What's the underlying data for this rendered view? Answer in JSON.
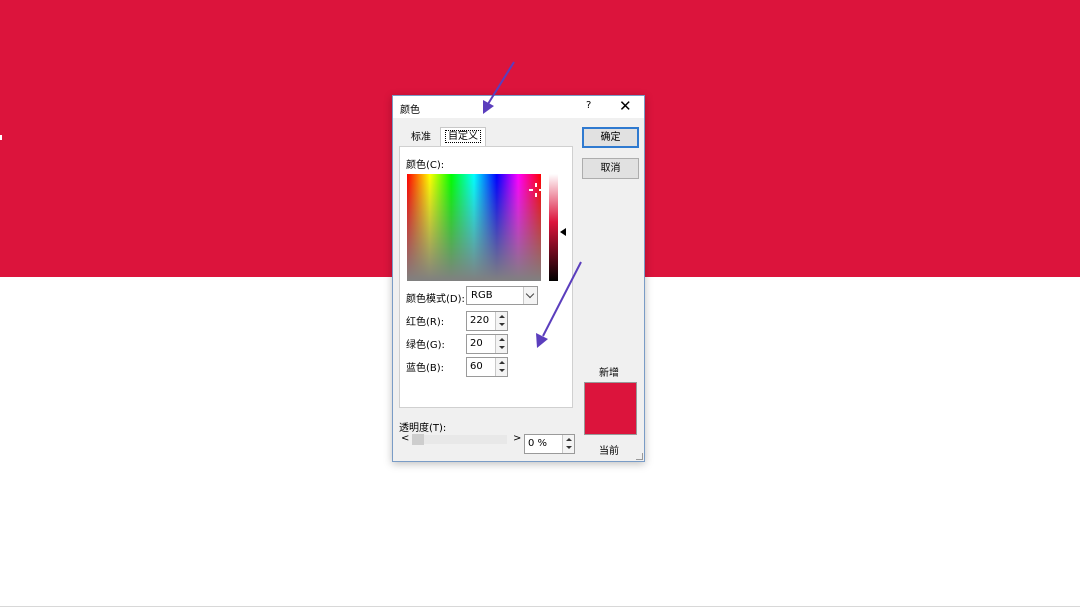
{
  "colors": {
    "background_band": "#dc143c",
    "current_color": "#dc143c",
    "annotation_arrow": "#5b3ebd"
  },
  "dialog": {
    "title": "颜色",
    "help_label": "?",
    "close_label": "✕",
    "tabs": [
      {
        "label": "标准",
        "selected": false
      },
      {
        "label": "自定义",
        "selected": true
      }
    ],
    "color_label": "颜色(C):",
    "color_model_label": "颜色模式(D):",
    "color_model_value": "RGB",
    "red_label": "红色(R):",
    "red_value": "220",
    "green_label": "绿色(G):",
    "green_value": "20",
    "blue_label": "蓝色(B):",
    "blue_value": "60",
    "ok_label": "确定",
    "cancel_label": "取消",
    "new_label": "新增",
    "current_label": "当前",
    "transparency_label": "透明度(T):",
    "transparency_value": "0 %",
    "scroll_left": "<",
    "scroll_right": ">"
  }
}
